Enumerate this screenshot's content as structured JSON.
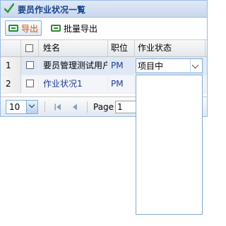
{
  "window": {
    "title": "要员作业状况一覧"
  },
  "toolbar": {
    "export_label": "导出",
    "batch_export_label": "批量导出"
  },
  "grid": {
    "columns": {
      "name": "姓名",
      "position": "职位",
      "status": "作业状态"
    },
    "rows": [
      {
        "num": "1",
        "name": "要员管理测试用户",
        "position": "PM",
        "status": "项目中"
      },
      {
        "num": "2",
        "name": "作业状况1",
        "position": "PM",
        "status": ""
      }
    ]
  },
  "combo": {
    "value": "项目中"
  },
  "pager": {
    "page_size": "10",
    "page_label": "Page",
    "page_value": "1"
  },
  "colors": {
    "accent": "#99bbe8",
    "title_text": "#15428b",
    "export_text": "#d35400"
  }
}
